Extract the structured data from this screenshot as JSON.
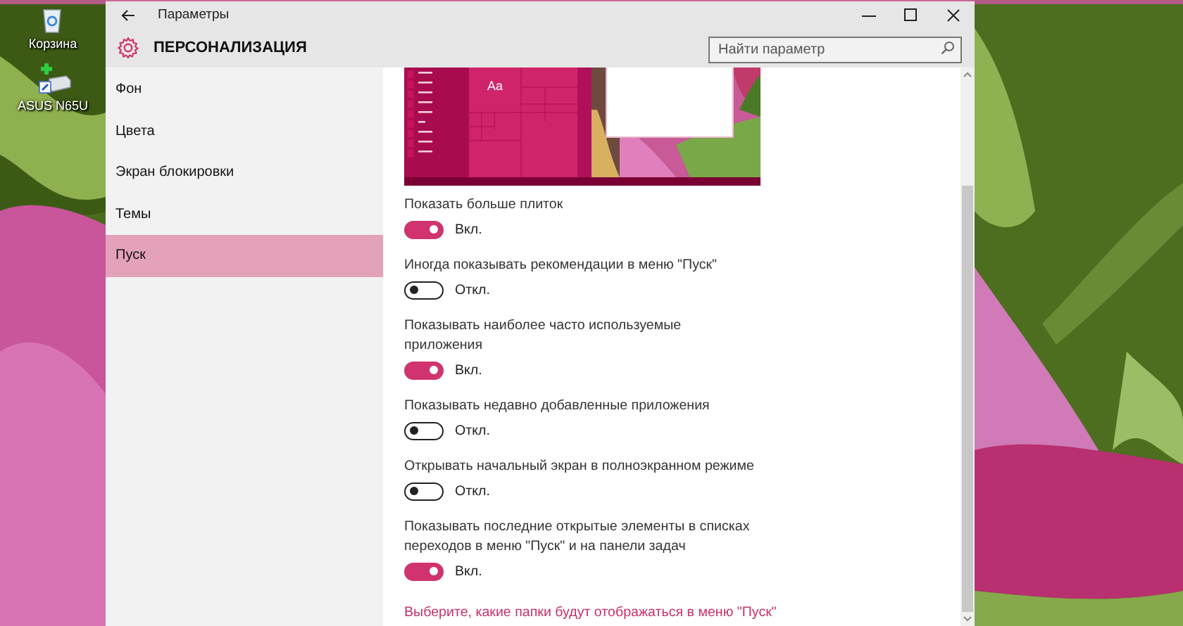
{
  "desktop_icons": [
    {
      "kind": "recycle",
      "label": "Корзина"
    },
    {
      "kind": "device",
      "label": "ASUS N65U"
    }
  ],
  "window": {
    "title": "Параметры"
  },
  "header": {
    "title": "ПЕРСОНАЛИЗАЦИЯ"
  },
  "search": {
    "placeholder": "Найти параметр"
  },
  "sidebar": {
    "items": [
      {
        "label": "Фон",
        "selected": false
      },
      {
        "label": "Цвета",
        "selected": false
      },
      {
        "label": "Экран блокировки",
        "selected": false
      },
      {
        "label": "Темы",
        "selected": false
      },
      {
        "label": "Пуск",
        "selected": true
      }
    ]
  },
  "preview": {
    "tile_label": "Aa"
  },
  "settings": [
    {
      "label": "Показать больше плиток",
      "on": true,
      "state_text": "Вкл."
    },
    {
      "label": "Иногда показывать рекомендации в меню \"Пуск\"",
      "on": false,
      "state_text": "Откл."
    },
    {
      "label": "Показывать наиболее часто используемые приложения",
      "on": true,
      "state_text": "Вкл."
    },
    {
      "label": "Показывать недавно добавленные приложения",
      "on": false,
      "state_text": "Откл."
    },
    {
      "label": "Открывать начальный экран в полноэкранном режиме",
      "on": false,
      "state_text": "Откл."
    },
    {
      "label": "Показывать последние открытые элементы в списках переходов в меню \"Пуск\" и на панели задач",
      "on": true,
      "state_text": "Вкл."
    }
  ],
  "link": "Выберите, какие папки будут отображаться в меню \"Пуск\""
}
